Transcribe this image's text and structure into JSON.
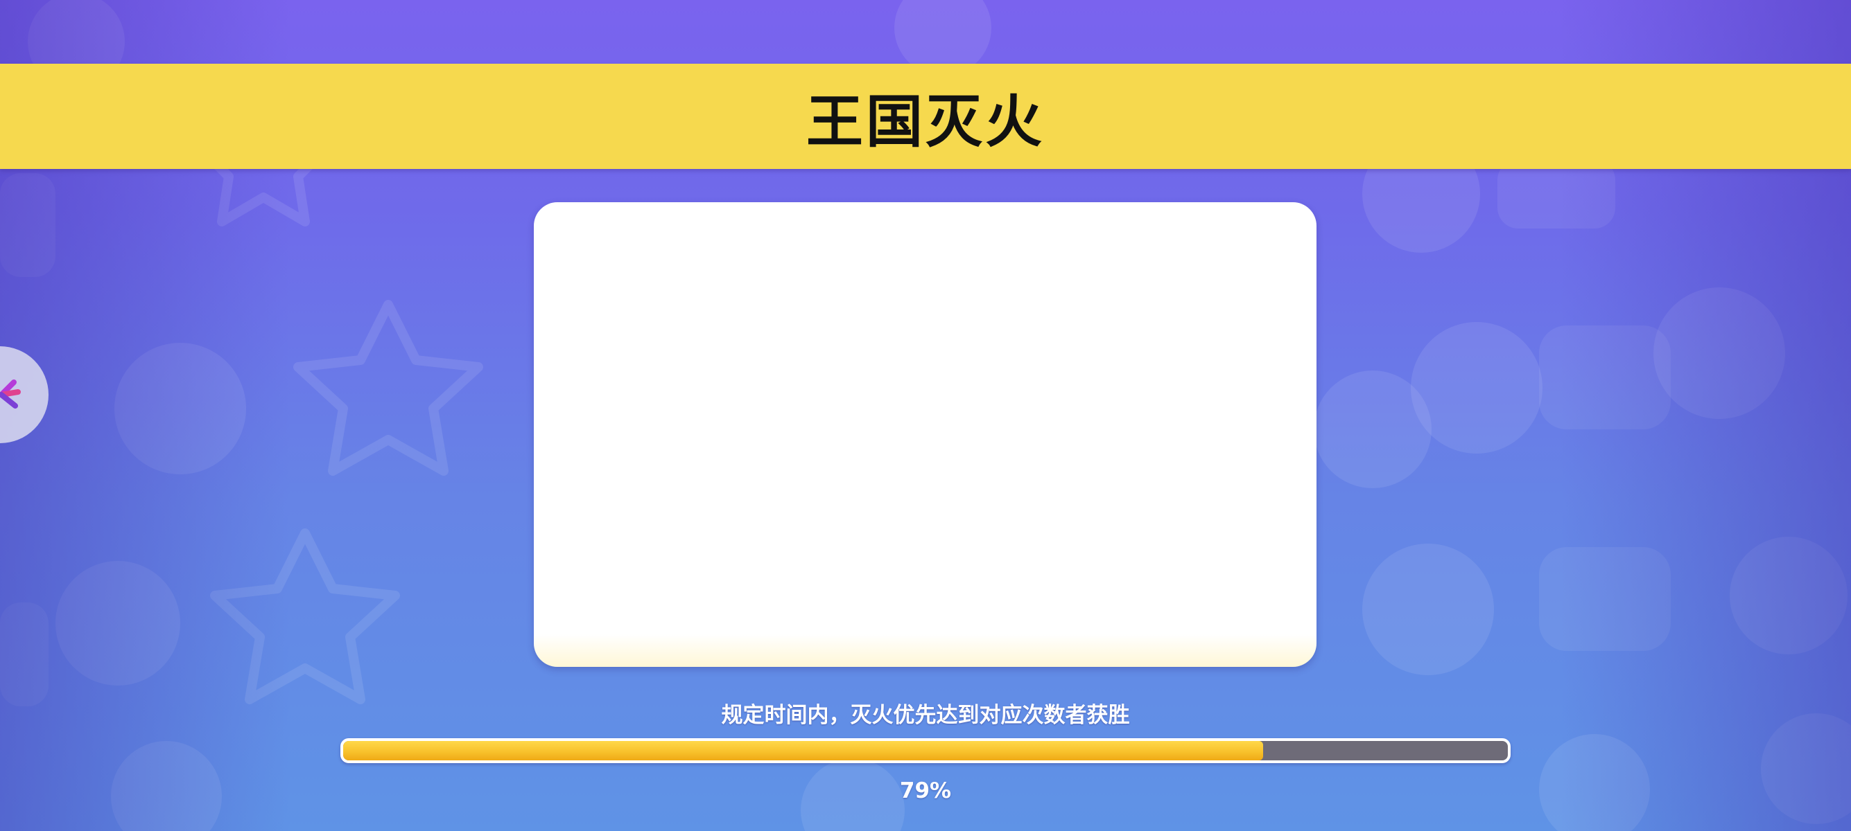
{
  "game": {
    "title": "王国灭火",
    "instruction": "规定时间内，灭火优先达到对应次数者获胜",
    "loading": {
      "progress_text": "79%",
      "progress_fraction": 0.79
    }
  },
  "side_menu": {
    "icon": "fan-menu-icon"
  },
  "colors": {
    "banner": "#f6d94e",
    "background_top": "#7a63ee",
    "background_bottom": "#5f93e6",
    "progress_fill": "#f8c22c",
    "progress_track": "#6e6b78"
  }
}
